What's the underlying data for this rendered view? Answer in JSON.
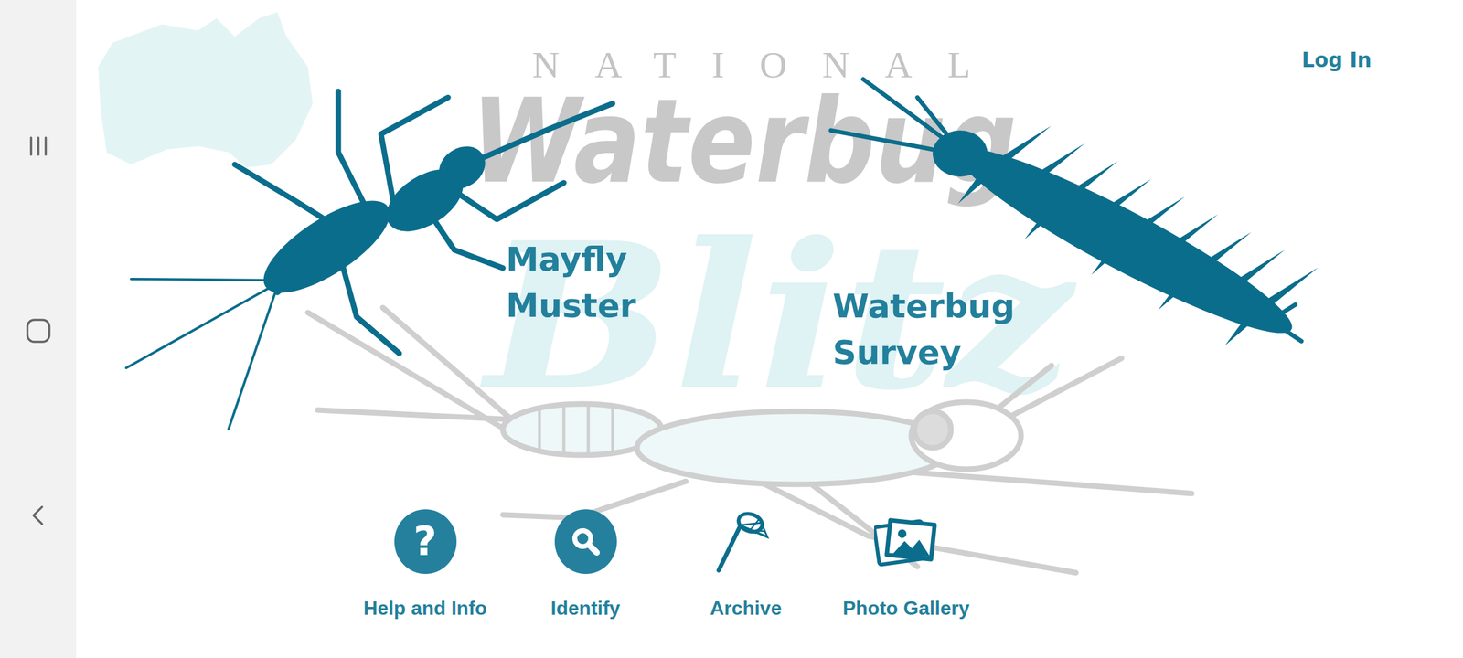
{
  "header": {
    "login": "Log In"
  },
  "title": {
    "top": "NATIONAL",
    "script": "Waterbug",
    "blitz": "Blitz"
  },
  "programs": [
    {
      "label": "Mayfly Muster"
    },
    {
      "label": "Waterbug Survey"
    }
  ],
  "menu": [
    {
      "label": "Help and Info",
      "kind": "question",
      "glyph": "?"
    },
    {
      "label": "Identify",
      "kind": "search"
    },
    {
      "label": "Archive",
      "kind": "net"
    },
    {
      "label": "Photo Gallery",
      "kind": "gallery"
    }
  ]
}
